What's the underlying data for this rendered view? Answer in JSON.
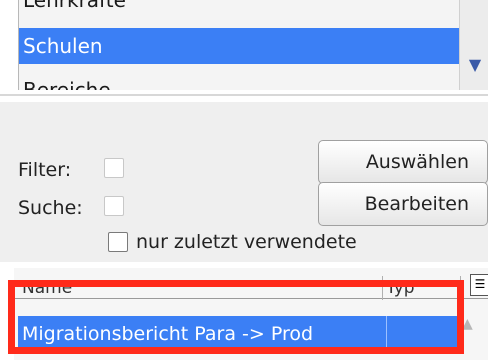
{
  "list": {
    "items": [
      "Lehrkräfte",
      "Schulen",
      "Bereiche"
    ],
    "selected_index": 1
  },
  "filter": {
    "label": "Filter:",
    "button_label": "Auswählen"
  },
  "search": {
    "label": "Suche:",
    "button_label": "Bearbeiten"
  },
  "recent_only": {
    "label": "nur zuletzt verwendete"
  },
  "table": {
    "columns": [
      "Name",
      "Typ"
    ],
    "rows": [
      {
        "name": "Migrationsbericht Para -> Prod",
        "typ": ""
      }
    ]
  },
  "colors": {
    "selection": "#3b7ff5",
    "highlight_border": "#ff2a1a"
  }
}
